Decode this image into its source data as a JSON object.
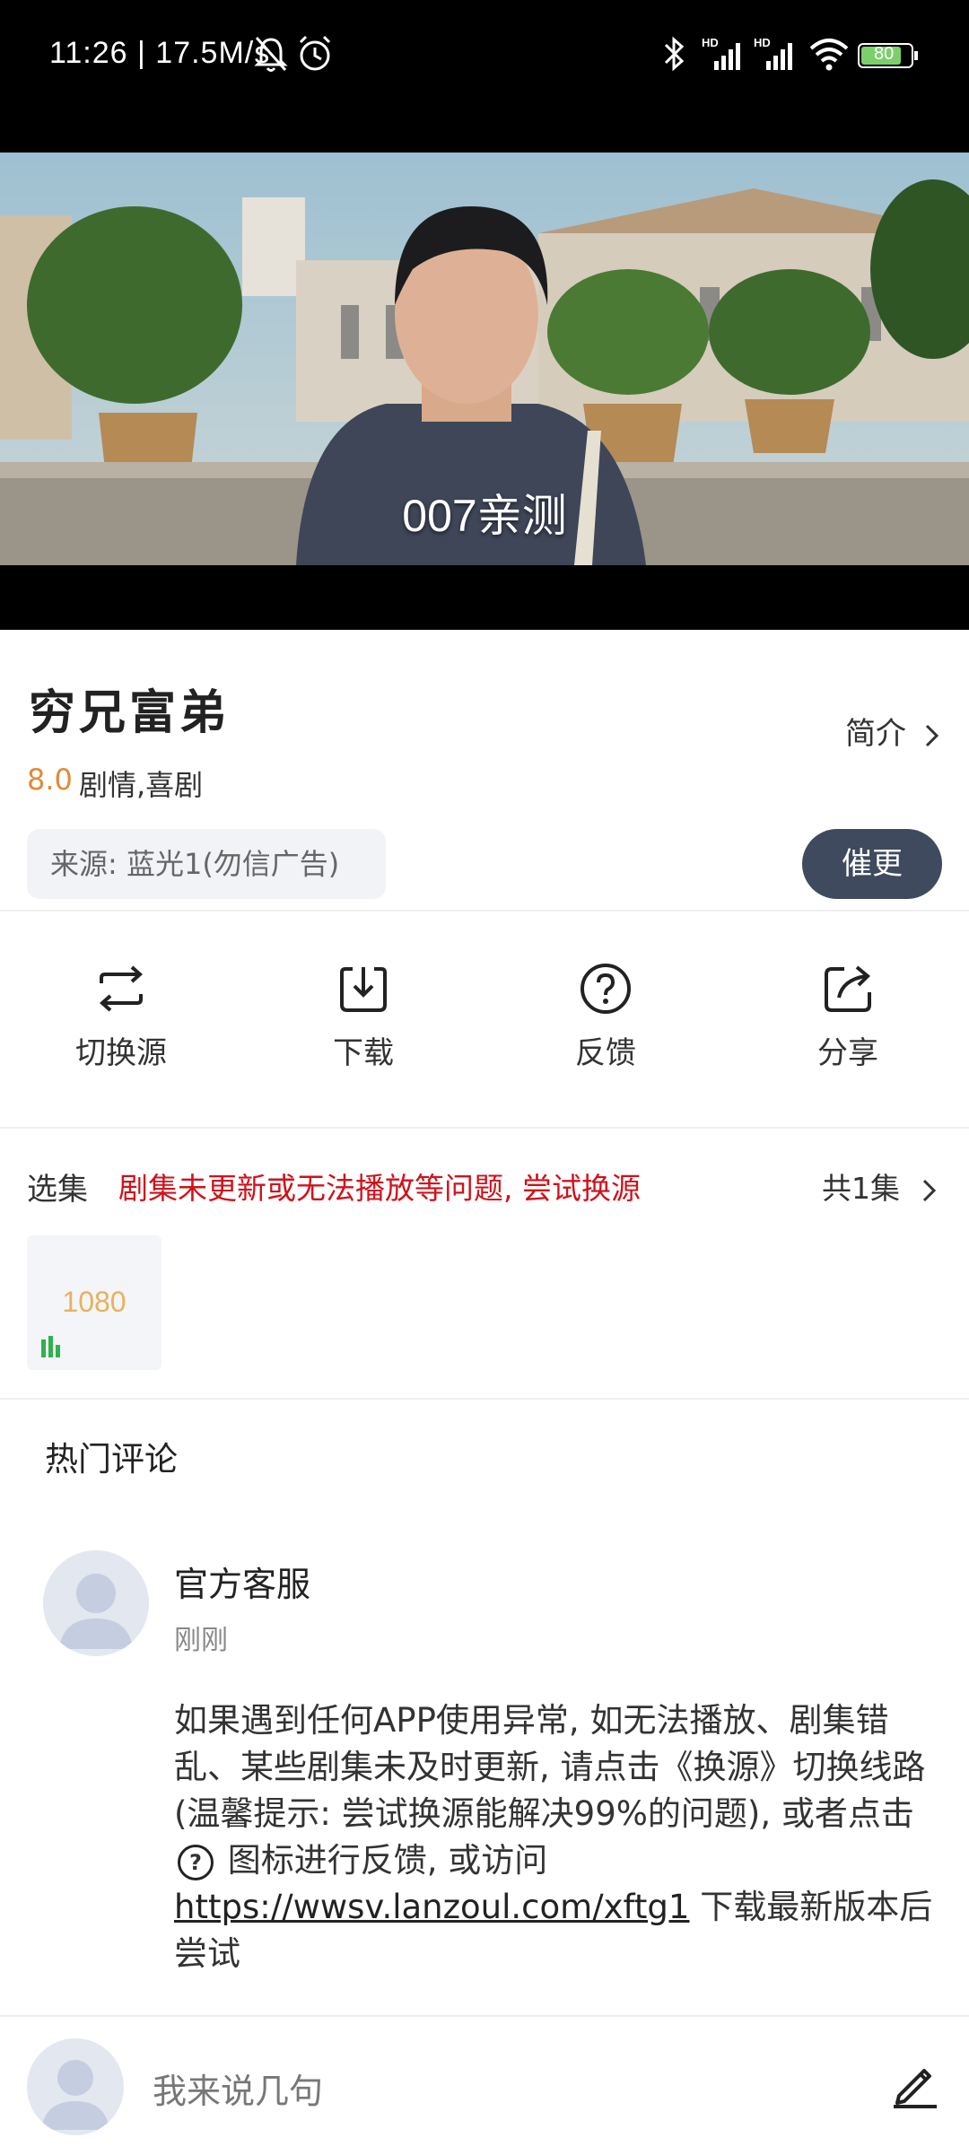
{
  "status_bar": {
    "time": "11:26 | 17.5M/s",
    "battery": "80",
    "icons": [
      "mute-bell-icon",
      "alarm-icon",
      "bluetooth-icon",
      "signal-hd-icon",
      "signal-hd-icon",
      "wifi-icon",
      "battery-icon"
    ]
  },
  "video": {
    "subtitle": "007亲测"
  },
  "show": {
    "title": "穷兄富弟",
    "intro_link": "简介",
    "rating": "8.0",
    "genre": "剧情,喜剧",
    "source": "来源: 蓝光1(勿信广告)",
    "urge_button": "催更"
  },
  "actions": [
    {
      "label": "切换源",
      "icon": "switch-source-icon"
    },
    {
      "label": "下载",
      "icon": "download-icon"
    },
    {
      "label": "反馈",
      "icon": "help-icon"
    },
    {
      "label": "分享",
      "icon": "share-icon"
    }
  ],
  "episodes": {
    "label": "选集",
    "warning": "剧集未更新或无法播放等问题, 尝试换源",
    "count": "共1集",
    "items": [
      {
        "label": "1080"
      }
    ]
  },
  "comments": {
    "section_title": "热门评论",
    "items": [
      {
        "author": "官方客服",
        "time": "刚刚",
        "text_before": "如果遇到任何APP使用异常, 如无法播放、剧集错乱、某些剧集未及时更新, 请点击《换源》切换线路(温馨提示: 尝试换源能解决99%的问题), 或者点击",
        "text_middle": "图标进行反馈, 或访问",
        "link": "https://wwsv.lanzoul.com/xftg1",
        "text_after": "下载最新版本后尝试"
      }
    ]
  },
  "bottom_bar": {
    "comment_placeholder": "我来说几句"
  },
  "colors": {
    "accent_dark": "#3f4a5e",
    "rating": "#e08a3a",
    "warning": "#d0121b",
    "episode_label": "#e8b25a",
    "playing_indicator": "#2db34a"
  }
}
